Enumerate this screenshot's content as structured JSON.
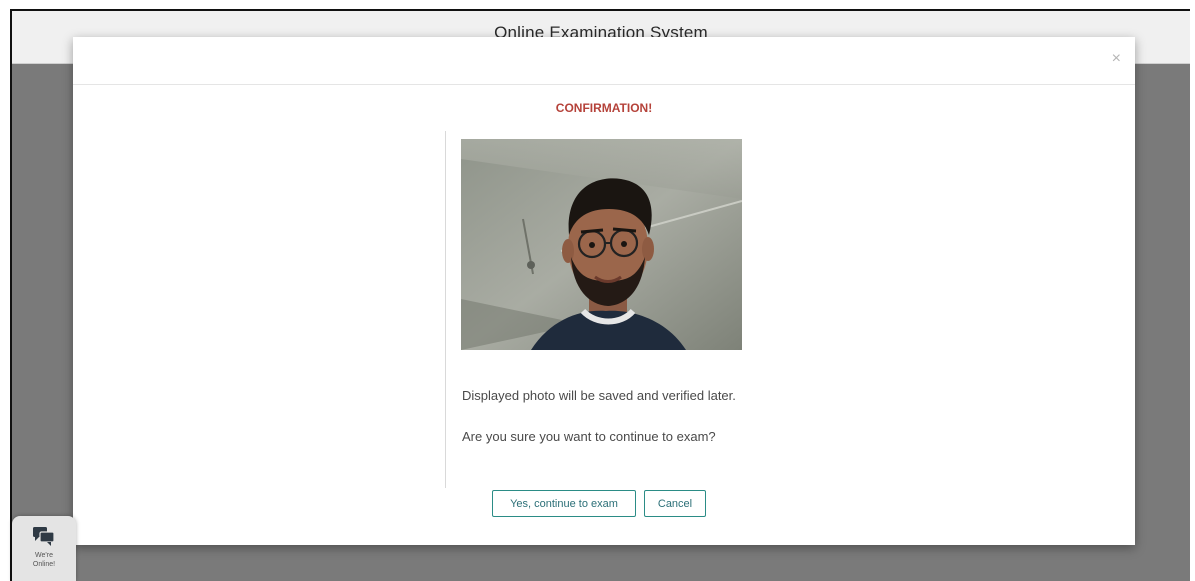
{
  "app": {
    "title": "Online Examination System"
  },
  "modal": {
    "close_label": "×",
    "heading": "CONFIRMATION!",
    "photo_description": "webcam capture of examinee",
    "message_saved": "Displayed photo will be saved and verified later.",
    "message_confirm": "Are you sure you want to continue to exam?",
    "continue_label": "Yes, continue to exam",
    "cancel_label": "Cancel"
  },
  "chat": {
    "icon": "chat-bubbles-icon",
    "line1": "We're",
    "line2": "Online!"
  },
  "colors": {
    "heading": "#b5423a",
    "button_border": "#2b8c86",
    "overlay": "#7a7a7a"
  }
}
